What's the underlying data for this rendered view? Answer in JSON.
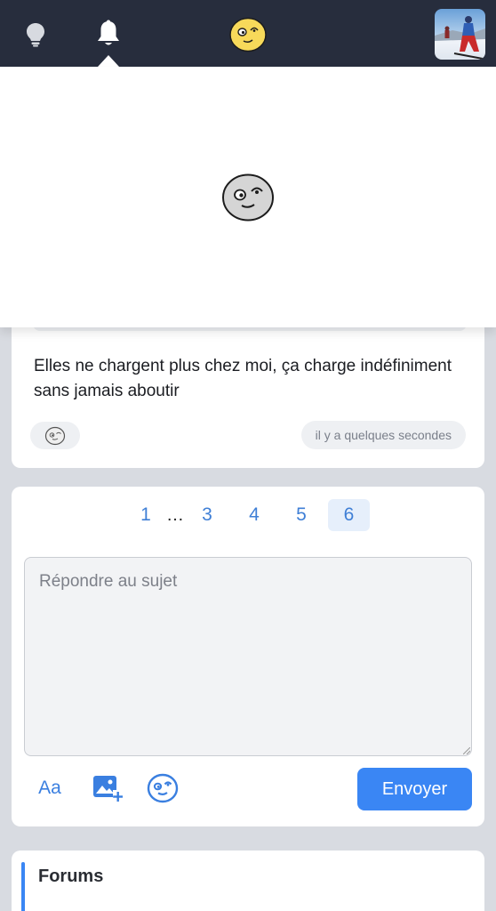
{
  "topbar": {
    "icons": [
      "lightbulb-icon",
      "bell-icon",
      "site-logo-face",
      "user-avatar"
    ],
    "colors": {
      "bar": "#272d3d",
      "icon": "#ffffff",
      "logo": "#f7d95a"
    }
  },
  "notifications": {
    "state": "empty",
    "icon": "grey-face-icon"
  },
  "post": {
    "text": "Elles ne chargent plus chez moi, ça charge indéfiniment sans jamais aboutir",
    "timestamp": "il y a quelques secondes",
    "reaction_icon": "face-reaction-icon"
  },
  "pagination": {
    "pages": [
      "1",
      "…",
      "3",
      "4",
      "5",
      "6"
    ],
    "current": "6"
  },
  "reply": {
    "placeholder": "Répondre au sujet",
    "value": "",
    "format_label": "Aa",
    "send_label": "Envoyer",
    "tool_icons": [
      "format-text-icon",
      "add-image-icon",
      "emoji-icon"
    ]
  },
  "forums": {
    "title": "Forums"
  },
  "accent_color": "#3a86f4"
}
